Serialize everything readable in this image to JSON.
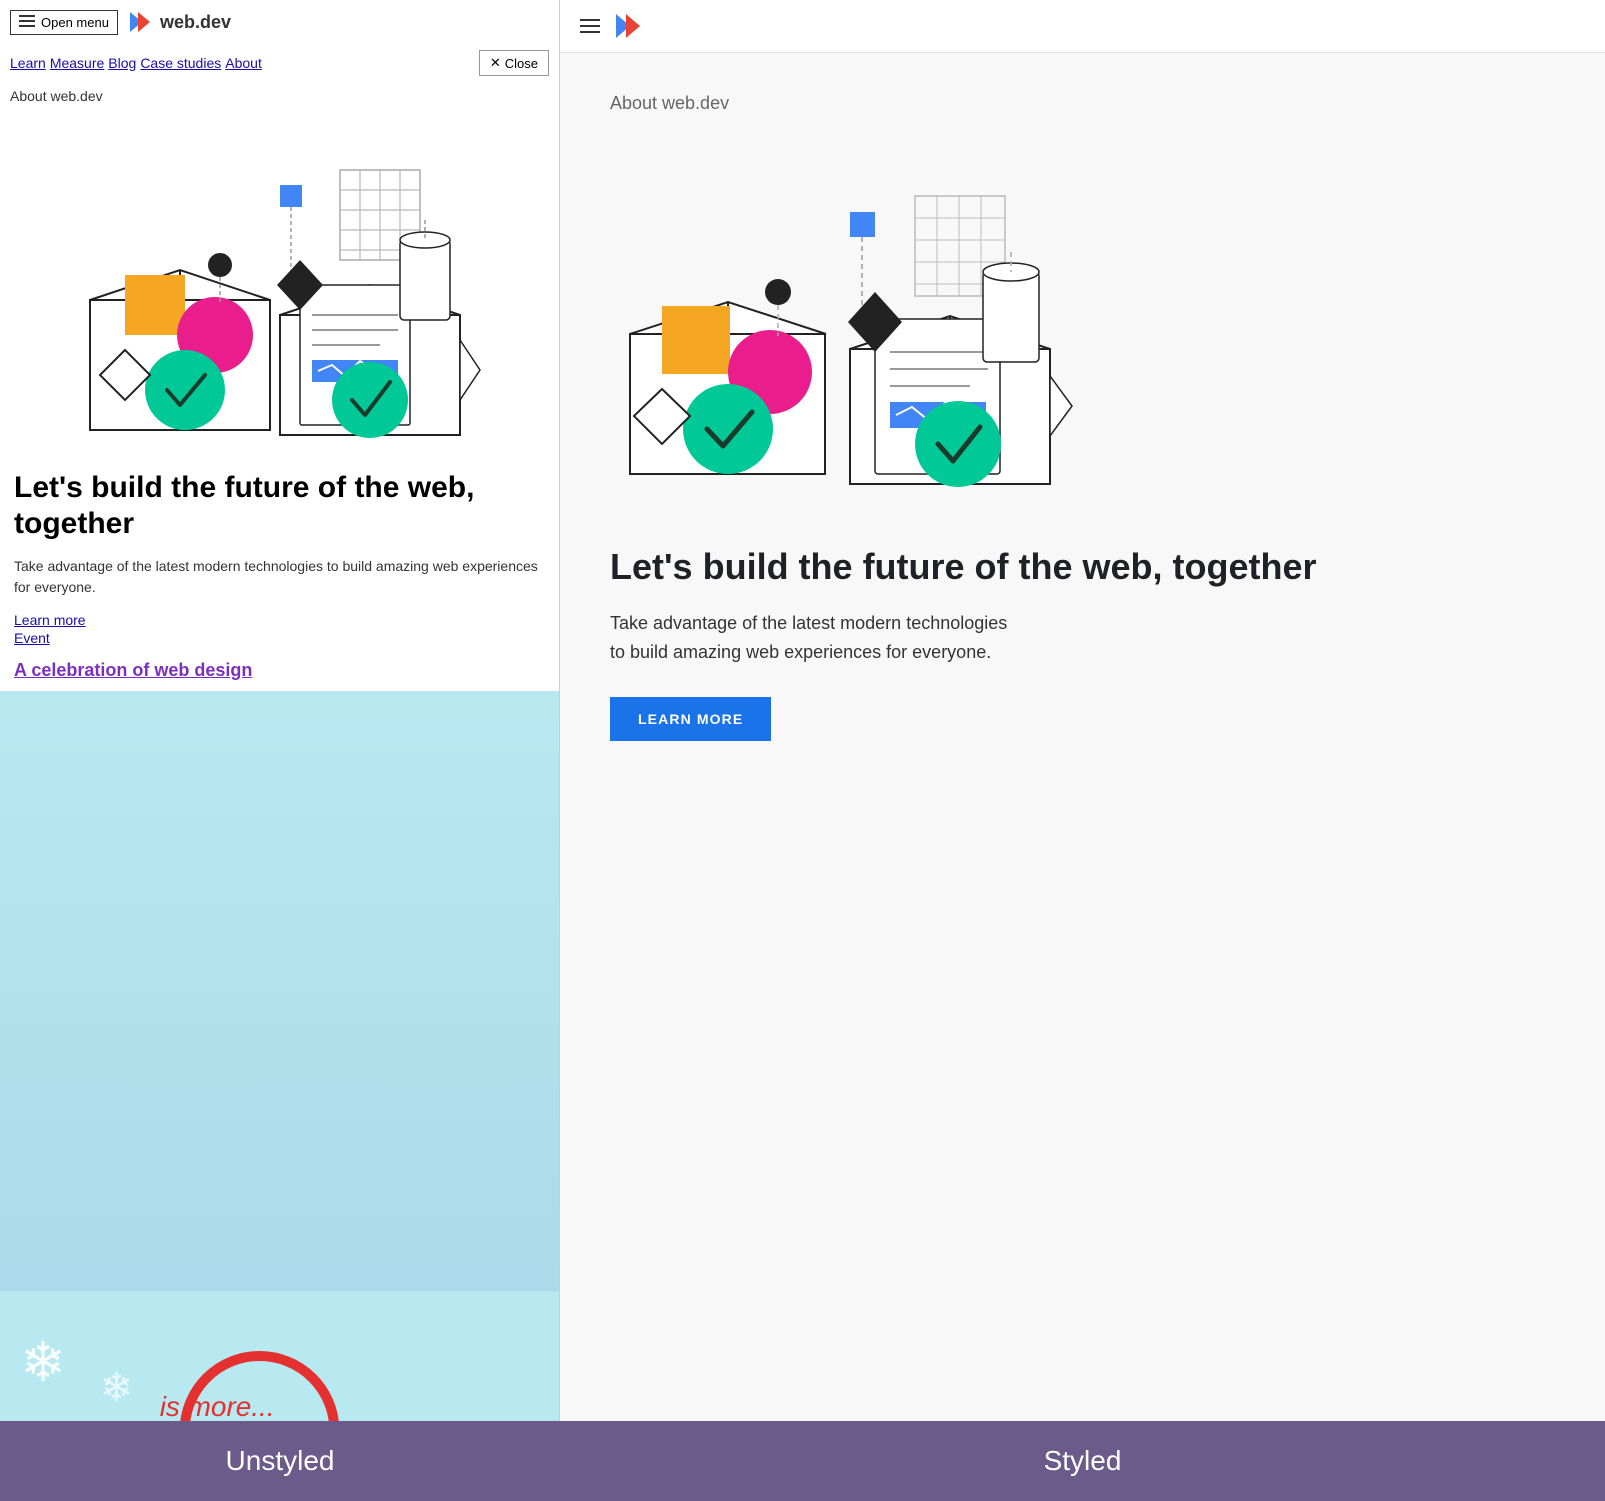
{
  "left": {
    "open_menu_label": "Open menu",
    "logo_text": "web.dev",
    "nav_links": [
      "Learn",
      "Measure",
      "Blog",
      "Case studies",
      "About"
    ],
    "close_label": "Close",
    "about_label": "About web.dev",
    "heading": "Let's build the future of the web, together",
    "description": "Take advantage of the latest modern technologies to build amazing web experiences for everyone.",
    "link_learn_more": "Learn more",
    "link_event": "Event",
    "link_celebration": "A celebration of web design"
  },
  "right": {
    "about_label": "About web.dev",
    "heading": "Let's build the future of the web, together",
    "description": "Take advantage of the latest modern technologies to build amazing web experiences for everyone.",
    "learn_more_btn": "LEARN MORE"
  },
  "bottom": {
    "unstyled_label": "Unstyled",
    "styled_label": "Styled"
  },
  "icons": {
    "hamburger": "☰",
    "close_x": "✕"
  }
}
